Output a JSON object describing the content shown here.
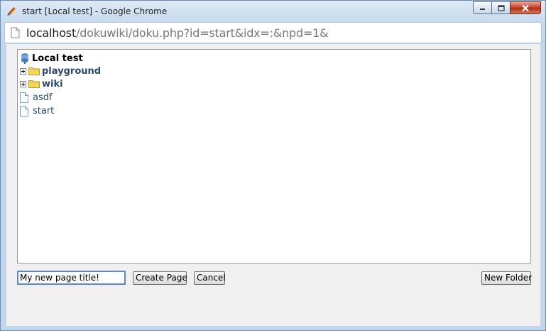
{
  "window": {
    "title": "start [Local test] - Google Chrome",
    "app_icon": "dokuwiki-icon",
    "controls": [
      "minimize-icon",
      "maximize-icon",
      "close-icon"
    ]
  },
  "addressbar": {
    "url_host": "localhost",
    "url_path": "/dokuwiki/doku.php?id=start&idx=:&npd=1&"
  },
  "tree": {
    "root": {
      "label": "Local test",
      "icon": "wiki-root-icon"
    },
    "namespaces": [
      {
        "label": "playground",
        "icon": "folder-icon",
        "expander": "plus-icon"
      },
      {
        "label": "wiki",
        "icon": "folder-icon",
        "expander": "plus-icon"
      }
    ],
    "pages": [
      {
        "label": "asdf",
        "icon": "page-icon"
      },
      {
        "label": "start",
        "icon": "page-icon"
      }
    ]
  },
  "form": {
    "page_title_value": "My new page title!",
    "create_label": "Create Page",
    "cancel_label": "Cancel",
    "new_folder_label": "New Folder"
  },
  "colors": {
    "link": "#2b4a6a",
    "input_focus_border": "#5d88c9",
    "close_button": "#c7452e"
  }
}
